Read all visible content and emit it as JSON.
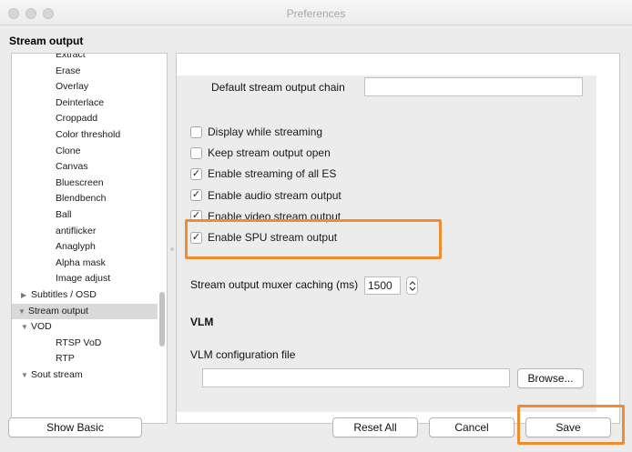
{
  "window": {
    "title": "Preferences"
  },
  "section_title": "Stream output",
  "tree": {
    "items": [
      {
        "label": "Extract",
        "indent": 2,
        "arrow": "",
        "selected": false
      },
      {
        "label": "Erase",
        "indent": 2,
        "arrow": "",
        "selected": false
      },
      {
        "label": "Overlay",
        "indent": 2,
        "arrow": "",
        "selected": false
      },
      {
        "label": "Deinterlace",
        "indent": 2,
        "arrow": "",
        "selected": false
      },
      {
        "label": "Croppadd",
        "indent": 2,
        "arrow": "",
        "selected": false
      },
      {
        "label": "Color threshold",
        "indent": 2,
        "arrow": "",
        "selected": false
      },
      {
        "label": "Clone",
        "indent": 2,
        "arrow": "",
        "selected": false
      },
      {
        "label": "Canvas",
        "indent": 2,
        "arrow": "",
        "selected": false
      },
      {
        "label": "Bluescreen",
        "indent": 2,
        "arrow": "",
        "selected": false
      },
      {
        "label": "Blendbench",
        "indent": 2,
        "arrow": "",
        "selected": false
      },
      {
        "label": "Ball",
        "indent": 2,
        "arrow": "",
        "selected": false
      },
      {
        "label": "antiflicker",
        "indent": 2,
        "arrow": "",
        "selected": false
      },
      {
        "label": "Anaglyph",
        "indent": 2,
        "arrow": "",
        "selected": false
      },
      {
        "label": "Alpha mask",
        "indent": 2,
        "arrow": "",
        "selected": false
      },
      {
        "label": "Image adjust",
        "indent": 2,
        "arrow": "",
        "selected": false
      },
      {
        "label": "Subtitles / OSD",
        "indent": 1,
        "arrow": "right",
        "selected": false
      },
      {
        "label": "Stream output",
        "indent": 0,
        "arrow": "down",
        "selected": true
      },
      {
        "label": "VOD",
        "indent": 1,
        "arrow": "down",
        "selected": false
      },
      {
        "label": "RTSP VoD",
        "indent": 2,
        "arrow": "",
        "selected": false
      },
      {
        "label": "RTP",
        "indent": 2,
        "arrow": "",
        "selected": false
      },
      {
        "label": "Sout stream",
        "indent": 1,
        "arrow": "down",
        "selected": false
      }
    ]
  },
  "settings": {
    "default_chain_label": "Default stream output chain",
    "default_chain_value": "",
    "checkboxes": [
      {
        "label": "Display while streaming",
        "checked": false
      },
      {
        "label": "Keep stream output open",
        "checked": false
      },
      {
        "label": "Enable streaming of all ES",
        "checked": true
      },
      {
        "label": "Enable audio stream output",
        "checked": true
      },
      {
        "label": "Enable video stream output",
        "checked": true
      },
      {
        "label": "Enable SPU stream output",
        "checked": true
      }
    ],
    "muxer_caching_label": "Stream output muxer caching (ms)",
    "muxer_caching_value": "1500",
    "vlm_heading": "VLM",
    "vlm_config_label": "VLM configuration file",
    "vlm_config_value": "",
    "browse_label": "Browse..."
  },
  "footer": {
    "show_basic": "Show Basic",
    "reset_all": "Reset All",
    "cancel": "Cancel",
    "save": "Save"
  },
  "colors": {
    "highlight": "#f28a30",
    "selected_row": "#d9d9d9"
  },
  "icons": {
    "checkmark": "check-icon",
    "stepper": "stepper-icon",
    "expand": "triangle-icon"
  }
}
